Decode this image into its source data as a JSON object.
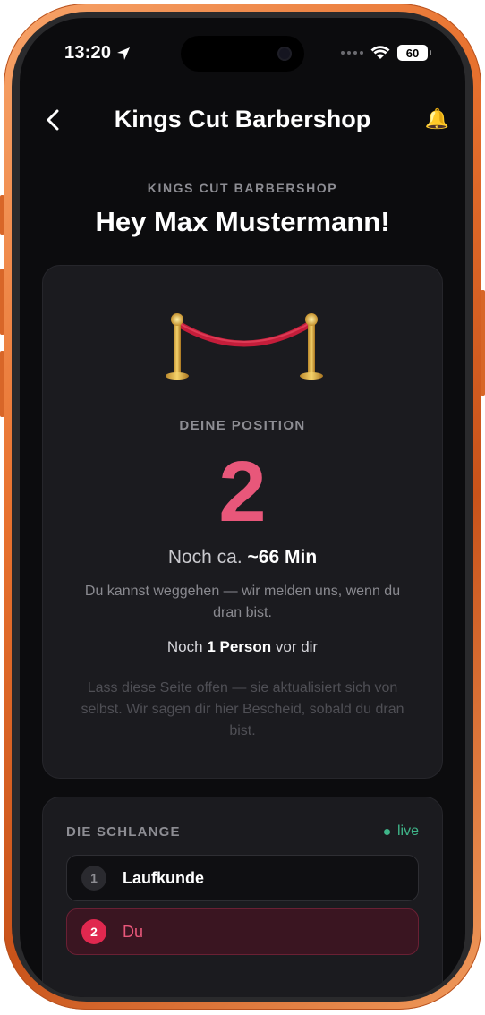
{
  "status_bar": {
    "time": "13:20",
    "battery": "60"
  },
  "nav": {
    "title": "Kings Cut Barbershop",
    "bell_icon": "🔔"
  },
  "header": {
    "shop_label": "KINGS CUT BARBERSHOP",
    "greeting": "Hey Max Mustermann!"
  },
  "position_card": {
    "label": "DEINE POSITION",
    "number": "2",
    "eta_prefix": "Noch ca.",
    "eta_value": "~66 Min",
    "info": "Du kannst weggehen — wir melden uns, wenn du dran bist.",
    "ahead_prefix": "Noch",
    "ahead_value": "1 Person",
    "ahead_suffix": "vor dir",
    "hint": "Lass diese Seite offen — sie aktualisiert sich von selbst. Wir sagen dir hier Bescheid, sobald du dran bist."
  },
  "queue": {
    "title": "DIE SCHLANGE",
    "live_label": "live",
    "items": [
      {
        "number": "1",
        "name": "Laufkunde"
      },
      {
        "number": "2",
        "name": "Du"
      }
    ]
  },
  "colors": {
    "accent": "#e8577a",
    "live": "#3fb589",
    "frame": "#e8722f"
  }
}
